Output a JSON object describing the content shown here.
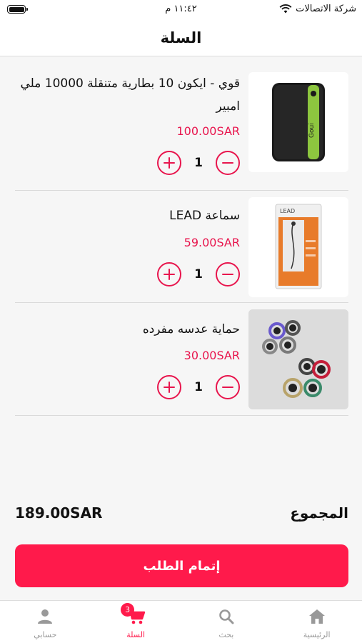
{
  "status_bar": {
    "carrier": "شركة الاتصالات",
    "time": "١١:٤٢ م"
  },
  "nav": {
    "title": "السلة"
  },
  "cart": {
    "items": [
      {
        "name": "قوي - ايكون 10 بطارية متنقلة 10000 ملي امبير",
        "price": "100.00SAR",
        "quantity": "1",
        "image_icon": "power-bank-image",
        "image_text": "Goui"
      },
      {
        "name": "سماعة LEAD",
        "price": "59.00SAR",
        "quantity": "1",
        "image_icon": "earphones-box-image",
        "image_text": "LEAD"
      },
      {
        "name": "حماية عدسه مفرده",
        "price": "30.00SAR",
        "quantity": "1",
        "image_icon": "lens-protectors-image",
        "image_text": ""
      }
    ]
  },
  "summary": {
    "total_label": "المجموع",
    "total_value": "189.00SAR"
  },
  "checkout": {
    "label": "إتمام الطلب"
  },
  "tab_bar": {
    "tabs": [
      {
        "label": "الرئيسية",
        "icon": "home-icon"
      },
      {
        "label": "بحث",
        "icon": "search-icon"
      },
      {
        "label": "السلة",
        "icon": "cart-icon",
        "badge": "3",
        "active": true
      },
      {
        "label": "حسابي",
        "icon": "person-icon"
      }
    ]
  },
  "colors": {
    "accent": "#ff1a4b",
    "price": "#e8154d",
    "inactive": "#999999"
  }
}
